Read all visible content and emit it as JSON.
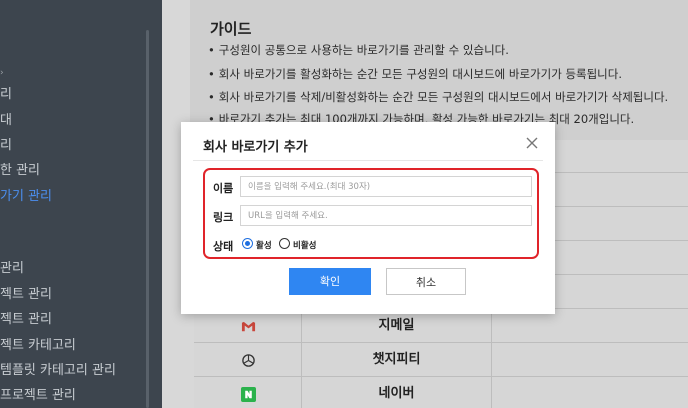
{
  "sidebar": {
    "items": [
      {
        "label": "리",
        "active": false
      },
      {
        "label": "대",
        "active": false
      },
      {
        "label": "리",
        "active": false
      },
      {
        "label": "한 관리",
        "active": false
      },
      {
        "label": "가기 관리",
        "active": true
      },
      {
        "label": "관리",
        "active": false
      },
      {
        "label": "젝트 관리",
        "active": false
      },
      {
        "label": "젝트 관리",
        "active": false
      },
      {
        "label": "젝트 카테고리",
        "active": false
      },
      {
        "label": "템플릿 카테고리 관리",
        "active": false
      },
      {
        "label": "프로젝트 관리",
        "active": false
      }
    ]
  },
  "guide": {
    "title": "가이드",
    "bullet": "•",
    "lines": [
      "구성원이 공통으로 사용하는 바로가기를 관리할 수 있습니다.",
      "회사 바로가기를 활성화하는 순간 모든 구성원의 대시보드에 바로가기가 등록됩니다.",
      "회사 바로가기를 삭제/비활성화하는 순간 모든 구성원의 대시보드에서 바로가기가 삭제됩니다.",
      "바로가기 추가는 최대 100개까지 가능하며, 활성 가능한 바로가기는 최대 20개입니다."
    ]
  },
  "table": {
    "rows": [
      {
        "name": "지메일",
        "icon": "gmail-icon"
      },
      {
        "name": "챗지피티",
        "icon": "chatgpt-icon"
      },
      {
        "name": "네이버",
        "icon": "naver-icon"
      }
    ]
  },
  "modal": {
    "title": "회사 바로가기 추가",
    "name_label": "이름",
    "name_placeholder": "이름을 입력해 주세요.(최대 30자)",
    "link_label": "링크",
    "link_placeholder": "URL을 입력해 주세요.",
    "status_label": "상태",
    "status_options": [
      {
        "label": "활성",
        "selected": true
      },
      {
        "label": "비활성",
        "selected": false
      }
    ],
    "confirm_label": "확인",
    "cancel_label": "취소"
  },
  "colors": {
    "accent": "#2f86f2",
    "highlight_border": "#e0242a",
    "sidebar_bg": "#3d454e",
    "sidebar_active": "#4b8ff0"
  }
}
